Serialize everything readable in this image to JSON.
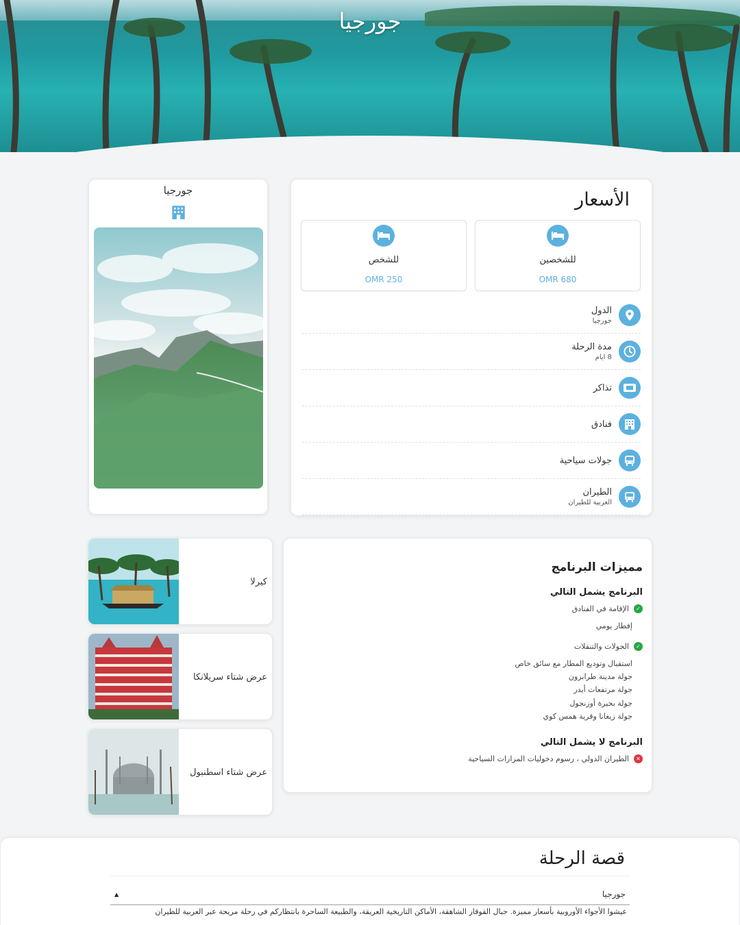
{
  "hero": {
    "title": "جورجيا"
  },
  "prices": {
    "heading": "الأسعار",
    "options": [
      {
        "label": "للشخصين",
        "value": "680 OMR",
        "icon": "bed-icon"
      },
      {
        "label": "للشخص",
        "value": "250 OMR",
        "icon": "bed-icon"
      }
    ],
    "details": [
      {
        "icon": "location-pin-icon",
        "label": "الدول",
        "value": "جورجيا"
      },
      {
        "icon": "clock-icon",
        "label": "مدة الرحلة",
        "value": "8 ايام"
      },
      {
        "icon": "ticket-icon",
        "label": "تذاكر",
        "value": ""
      },
      {
        "icon": "hotel-icon",
        "label": "فنادق",
        "value": ""
      },
      {
        "icon": "bus-icon",
        "label": "جولات سياحية",
        "value": ""
      },
      {
        "icon": "bus-icon",
        "label": "الطيران",
        "value": "العربية للطيران"
      }
    ]
  },
  "destination": {
    "title": "جورجيا",
    "icon": "hotel-icon"
  },
  "features": {
    "heading": "مميزات البرنامج",
    "included_title": "البرنامج يشمل التالي",
    "included": [
      {
        "label": "الإقامة في الفنادق",
        "details": [
          "إفطار يومي"
        ]
      },
      {
        "label": "الجولات والتنقلات",
        "details": [
          "استقبال وتوديع المطار مع سائق خاص",
          "جولة مدينة طرابزون",
          "جولة مرتفعات أيدر",
          "جولة بحيرة أوزنجول",
          "جولة زيغانا وقرية همس كوي"
        ]
      }
    ],
    "excluded_title": "البرنامج لا يشمل التالي",
    "excluded": [
      "الطيران الدولي ، رسوم دخوليات المزارات السياحية"
    ]
  },
  "offers": [
    {
      "label": "كيرلا"
    },
    {
      "label": "عرض شتاء سريلانكا"
    },
    {
      "label": "عرض شتاء اسطنبول"
    }
  ],
  "story": {
    "heading": "قصة الرحلة",
    "accordion_title": "جورجيا",
    "accordion_icon": "caret-up-icon",
    "body": "عيشوا الأجواء الأوروبية بأسعار مميزة. جبال القوقاز الشاهقة، الأماكن التاريخية العريقة، والطبيعة الساحرة بانتظاركم في رحلة مريحة عبر العربية للطيران"
  },
  "colors": {
    "accent": "#5cb1df",
    "included": "#27a745",
    "excluded": "#dc3545"
  }
}
